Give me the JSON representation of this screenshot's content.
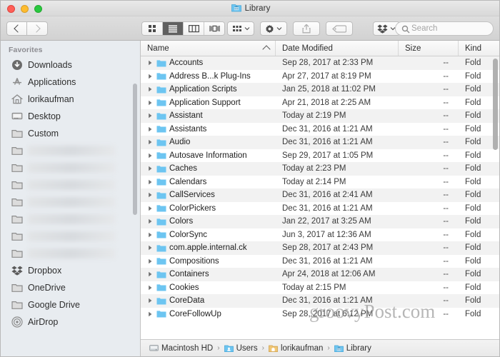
{
  "window": {
    "title": "Library",
    "title_icon": "library-folder-icon",
    "traffic_lights": [
      {
        "name": "close-button",
        "color": "#ff5f57"
      },
      {
        "name": "minimize-button",
        "color": "#febc2e"
      },
      {
        "name": "maximize-button",
        "color": "#28c840"
      }
    ]
  },
  "toolbar": {
    "back_label": "Back",
    "forward_label": "Forward",
    "view_modes": [
      {
        "name": "icon-view",
        "label": "Icon View",
        "active": false
      },
      {
        "name": "list-view",
        "label": "List View",
        "active": true
      },
      {
        "name": "column-view",
        "label": "Column View",
        "active": false
      },
      {
        "name": "gallery-view",
        "label": "Gallery View",
        "active": false
      }
    ],
    "arrange_label": "Arrange",
    "action_label": "Action",
    "share_label": "Share",
    "tags_label": "Tags",
    "dropbox_label": "Dropbox",
    "search_placeholder": "Search"
  },
  "sidebar": {
    "section_title": "Favorites",
    "items": [
      {
        "label": "Downloads",
        "icon": "downloads-icon",
        "redacted": false
      },
      {
        "label": "Applications",
        "icon": "applications-icon",
        "redacted": false
      },
      {
        "label": "lorikaufman",
        "icon": "home-icon",
        "redacted": false
      },
      {
        "label": "Desktop",
        "icon": "desktop-icon",
        "redacted": false
      },
      {
        "label": "Custom",
        "icon": "folder-icon",
        "redacted": false
      },
      {
        "label": "",
        "icon": "folder-icon",
        "redacted": true
      },
      {
        "label": "",
        "icon": "folder-icon",
        "redacted": true
      },
      {
        "label": "",
        "icon": "folder-icon",
        "redacted": true
      },
      {
        "label": "",
        "icon": "folder-icon",
        "redacted": true
      },
      {
        "label": "",
        "icon": "folder-icon",
        "redacted": true
      },
      {
        "label": "",
        "icon": "folder-icon",
        "redacted": true
      },
      {
        "label": "",
        "icon": "folder-icon",
        "redacted": true
      },
      {
        "label": "Dropbox",
        "icon": "dropbox-icon",
        "redacted": false
      },
      {
        "label": "OneDrive",
        "icon": "folder-icon",
        "redacted": false
      },
      {
        "label": "Google Drive",
        "icon": "folder-icon",
        "redacted": false
      },
      {
        "label": "AirDrop",
        "icon": "airdrop-icon",
        "redacted": false
      }
    ]
  },
  "file_list": {
    "columns": [
      {
        "key": "name",
        "label": "Name",
        "sorted": true,
        "sort_direction": "ascending"
      },
      {
        "key": "date",
        "label": "Date Modified",
        "sorted": false
      },
      {
        "key": "size",
        "label": "Size",
        "sorted": false
      },
      {
        "key": "kind",
        "label": "Kind",
        "sorted": false
      }
    ],
    "rows": [
      {
        "name": "Accounts",
        "date": "Sep 28, 2017 at 2:33 PM",
        "size": "--",
        "kind": "Fold"
      },
      {
        "name": "Address B...k Plug-Ins",
        "date": "Apr 27, 2017 at 8:19 PM",
        "size": "--",
        "kind": "Fold"
      },
      {
        "name": "Application Scripts",
        "date": "Jan 25, 2018 at 11:02 PM",
        "size": "--",
        "kind": "Fold"
      },
      {
        "name": "Application Support",
        "date": "Apr 21, 2018 at 2:25 AM",
        "size": "--",
        "kind": "Fold"
      },
      {
        "name": "Assistant",
        "date": "Today at 2:19 PM",
        "size": "--",
        "kind": "Fold"
      },
      {
        "name": "Assistants",
        "date": "Dec 31, 2016 at 1:21 AM",
        "size": "--",
        "kind": "Fold"
      },
      {
        "name": "Audio",
        "date": "Dec 31, 2016 at 1:21 AM",
        "size": "--",
        "kind": "Fold"
      },
      {
        "name": "Autosave Information",
        "date": "Sep 29, 2017 at 1:05 PM",
        "size": "--",
        "kind": "Fold"
      },
      {
        "name": "Caches",
        "date": "Today at 2:23 PM",
        "size": "--",
        "kind": "Fold"
      },
      {
        "name": "Calendars",
        "date": "Today at 2:14 PM",
        "size": "--",
        "kind": "Fold"
      },
      {
        "name": "CallServices",
        "date": "Dec 31, 2016 at 2:41 AM",
        "size": "--",
        "kind": "Fold"
      },
      {
        "name": "ColorPickers",
        "date": "Dec 31, 2016 at 1:21 AM",
        "size": "--",
        "kind": "Fold"
      },
      {
        "name": "Colors",
        "date": "Jan 22, 2017 at 3:25 AM",
        "size": "--",
        "kind": "Fold"
      },
      {
        "name": "ColorSync",
        "date": "Jun 3, 2017 at 12:36 AM",
        "size": "--",
        "kind": "Fold"
      },
      {
        "name": "com.apple.internal.ck",
        "date": "Sep 28, 2017 at 2:43 PM",
        "size": "--",
        "kind": "Fold"
      },
      {
        "name": "Compositions",
        "date": "Dec 31, 2016 at 1:21 AM",
        "size": "--",
        "kind": "Fold"
      },
      {
        "name": "Containers",
        "date": "Apr 24, 2018 at 12:06 AM",
        "size": "--",
        "kind": "Fold"
      },
      {
        "name": "Cookies",
        "date": "Today at 2:15 PM",
        "size": "--",
        "kind": "Fold"
      },
      {
        "name": "CoreData",
        "date": "Dec 31, 2016 at 1:21 AM",
        "size": "--",
        "kind": "Fold"
      },
      {
        "name": "CoreFollowUp",
        "date": "Sep 28, 2017 at 6:12 PM",
        "size": "--",
        "kind": "Fold"
      }
    ]
  },
  "path_bar": {
    "crumbs": [
      {
        "label": "Macintosh HD",
        "icon": "hard-drive-icon"
      },
      {
        "label": "Users",
        "icon": "users-folder-icon"
      },
      {
        "label": "lorikaufman",
        "icon": "home-folder-icon"
      },
      {
        "label": "Library",
        "icon": "library-folder-icon"
      }
    ],
    "separator": "›"
  },
  "watermark": {
    "text": "groovyPost.com"
  },
  "colors": {
    "folder_blue": "#6dc5f1",
    "sidebar_bg": "#e8ecf0",
    "row_stripe": "#f2f2f2",
    "accent_selected": "#606060"
  }
}
